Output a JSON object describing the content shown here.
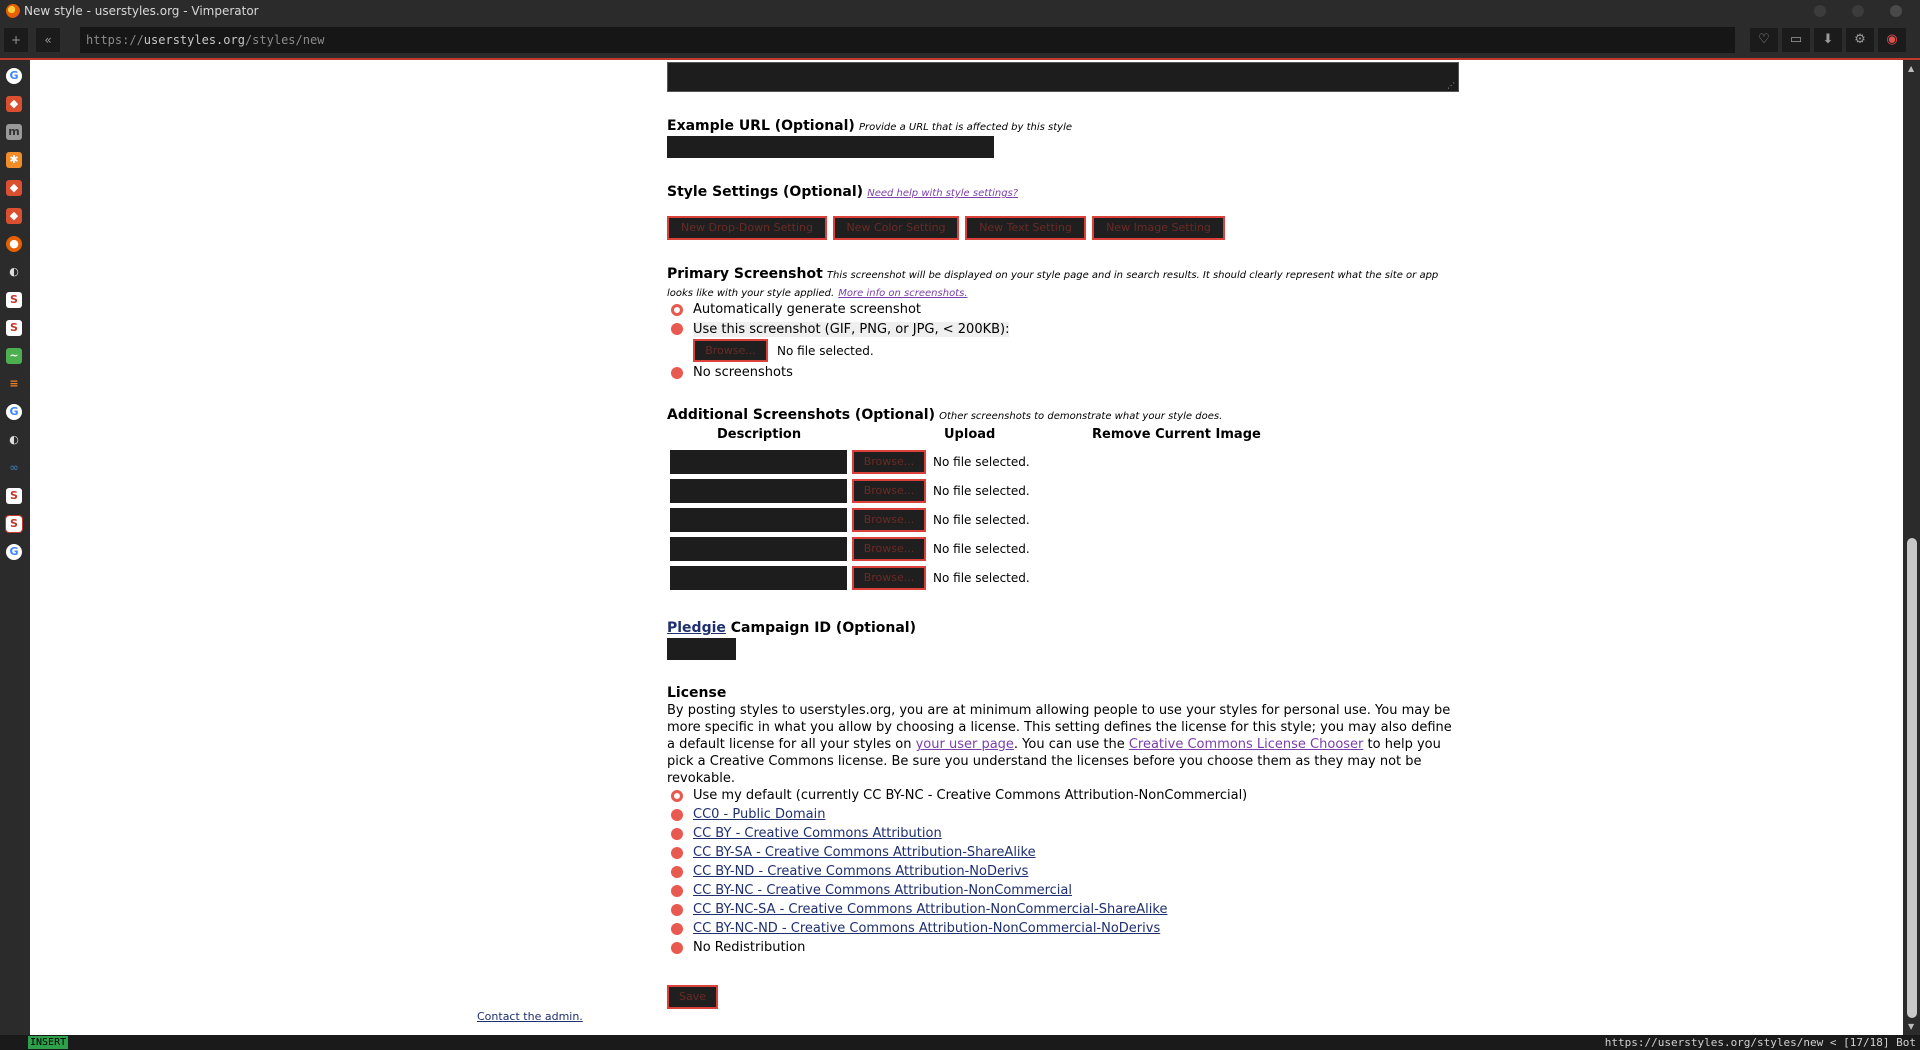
{
  "window": {
    "title": "New style - userstyles.org - Vimperator"
  },
  "toolbar": {
    "back_label": "«",
    "add_label": "+",
    "url_prefix": "https://",
    "url_host": "userstyles.org",
    "url_path": "/styles/new",
    "icons": [
      "heart-icon",
      "inbox-icon",
      "download-icon",
      "gear-icon",
      "vimperator-icon"
    ]
  },
  "sidebar": {
    "icons": [
      "google-icon",
      "userstyles-icon",
      "mail-icon",
      "snowflake-icon",
      "userstyles-icon",
      "userstyles-icon",
      "firefox-icon",
      "github-icon",
      "stylish-icon",
      "stylish-icon",
      "chart-icon",
      "stack-icon",
      "google-icon",
      "github-icon",
      "link-icon",
      "stylish-icon",
      "stylish-icon",
      "google-icon"
    ]
  },
  "form": {
    "example_url": {
      "label": "Example URL (Optional)",
      "hint": "Provide a URL that is affected by this style"
    },
    "style_settings": {
      "label": "Style Settings (Optional)",
      "help_link": "Need help with style settings?",
      "buttons": [
        "New Drop-Down Setting",
        "New Color Setting",
        "New Text Setting",
        "New Image Setting"
      ]
    },
    "primary_screenshot": {
      "label": "Primary Screenshot",
      "hint": "This screenshot will be displayed on your style page and in search results. It should clearly represent what the site or app looks like with your style applied.",
      "more_link": "More info on screenshots.",
      "option_auto": "Automatically generate screenshot",
      "option_use": "Use this screenshot (GIF, PNG, or JPG, < 200KB):",
      "browse": "Browse...",
      "no_file": "No file selected.",
      "option_none": "No screenshots"
    },
    "additional_screenshots": {
      "label": "Additional Screenshots (Optional)",
      "hint": "Other screenshots to demonstrate what your style does.",
      "columns": [
        "Description",
        "Upload",
        "Remove Current Image"
      ],
      "rows": [
        {
          "browse": "Browse...",
          "status": "No file selected."
        },
        {
          "browse": "Browse...",
          "status": "No file selected."
        },
        {
          "browse": "Browse...",
          "status": "No file selected."
        },
        {
          "browse": "Browse...",
          "status": "No file selected."
        },
        {
          "browse": "Browse...",
          "status": "No file selected."
        }
      ]
    },
    "pledgie": {
      "link": "Pledgie",
      "label": "Campaign ID (Optional)"
    },
    "license": {
      "label": "License",
      "para_1": "By posting styles to userstyles.org, you are at minimum allowing people to use your styles for personal use. You may be more specific in what you allow by choosing a license. This setting defines the license for this style; you may also define a default license for all your styles on ",
      "user_page_link": "your user page",
      "para_2": ". You can use the ",
      "chooser_link": "Creative Commons License Chooser",
      "para_3": " to help you pick a Creative Commons license. Be sure you understand the licenses before you choose them as they may not be revokable.",
      "options": [
        "Use my default (currently CC BY-NC - Creative Commons Attribution-NonCommercial)",
        "CC0 - Public Domain",
        "CC BY - Creative Commons Attribution",
        "CC BY-SA - Creative Commons Attribution-ShareAlike",
        "CC BY-ND - Creative Commons Attribution-NoDerivs",
        "CC BY-NC - Creative Commons Attribution-NonCommercial",
        "CC BY-NC-SA - Creative Commons Attribution-NonCommercial-ShareAlike",
        "CC BY-NC-ND - Creative Commons Attribution-NonCommercial-NoDerivs",
        "No Redistribution"
      ]
    },
    "save_label": "Save"
  },
  "footer": {
    "contact": "Contact the admin."
  },
  "statusbar": {
    "mode": "INSERT",
    "url": "https://userstyles.org/styles/new < [17/18] Bot"
  },
  "colors": {
    "accent_red": "#d9413a",
    "radio_red": "#e8594f",
    "dark_field": "#1d1d1d",
    "link_purple": "#7a3fa8"
  }
}
